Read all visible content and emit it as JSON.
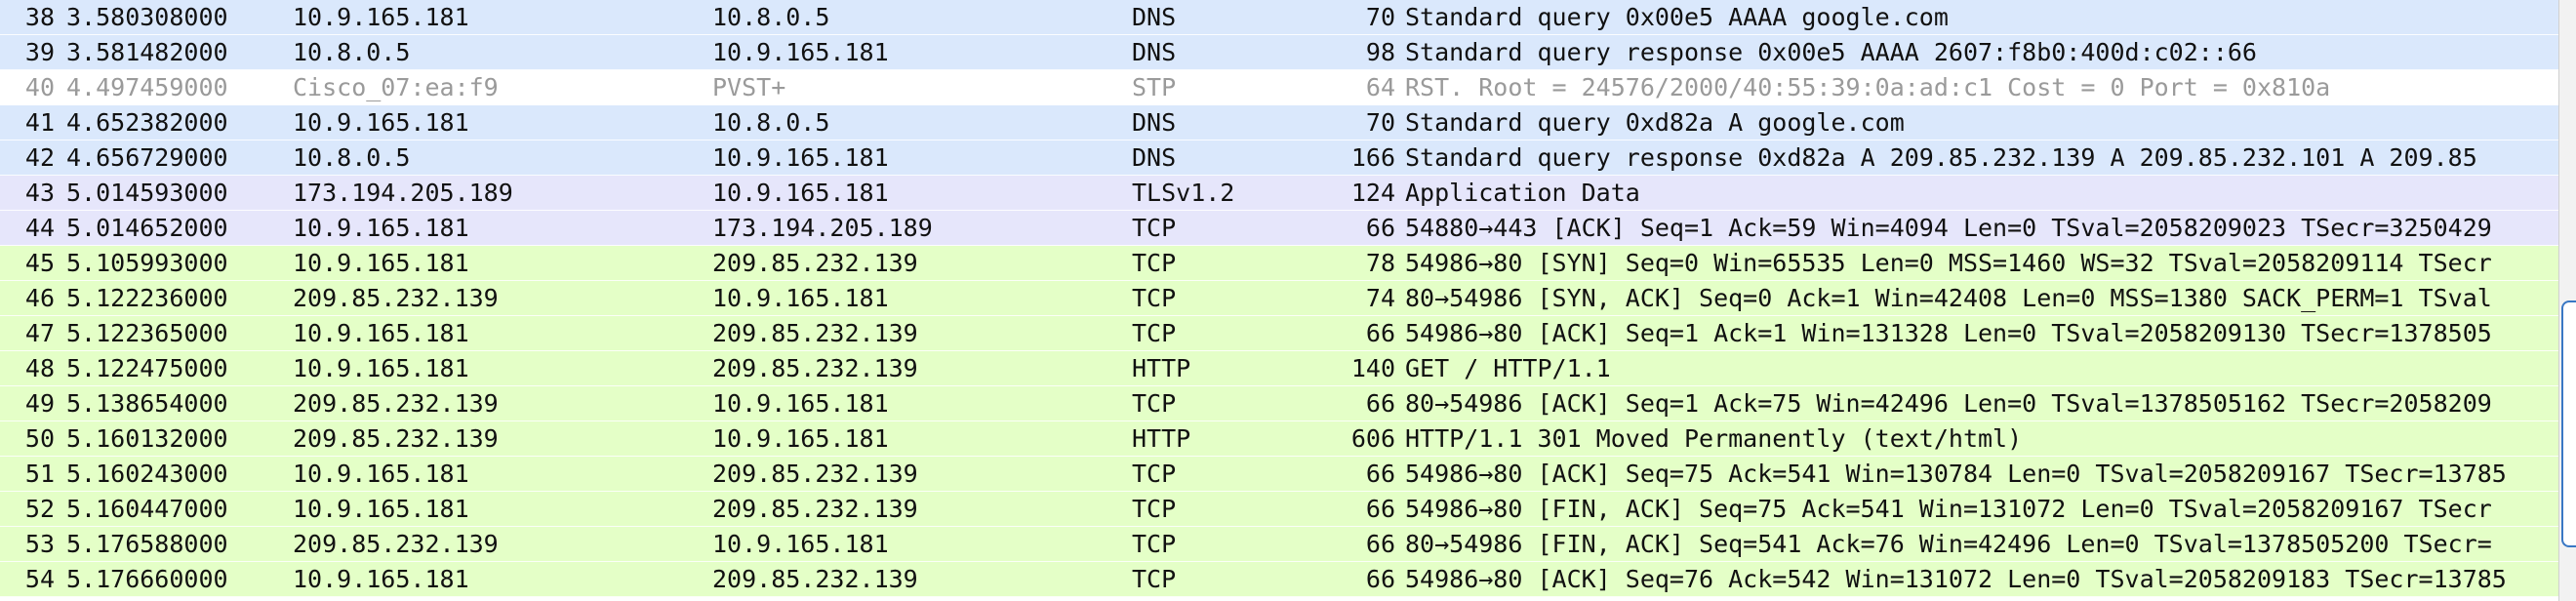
{
  "rows": [
    {
      "no": "38",
      "time": "3.580308000",
      "src": "10.9.165.181",
      "dst": "10.8.0.5",
      "proto": "DNS",
      "len": "70",
      "info": "Standard query 0x00e5  AAAA google.com",
      "kind": "dns"
    },
    {
      "no": "39",
      "time": "3.581482000",
      "src": "10.8.0.5",
      "dst": "10.9.165.181",
      "proto": "DNS",
      "len": "98",
      "info": "Standard query response 0x00e5  AAAA 2607:f8b0:400d:c02::66",
      "kind": "dns"
    },
    {
      "no": "40",
      "time": "4.497459000",
      "src": "Cisco_07:ea:f9",
      "dst": "PVST+",
      "proto": "STP",
      "len": "64",
      "info": "RST. Root = 24576/2000/40:55:39:0a:ad:c1  Cost = 0  Port = 0x810a",
      "kind": "stp"
    },
    {
      "no": "41",
      "time": "4.652382000",
      "src": "10.9.165.181",
      "dst": "10.8.0.5",
      "proto": "DNS",
      "len": "70",
      "info": "Standard query 0xd82a  A google.com",
      "kind": "dns"
    },
    {
      "no": "42",
      "time": "4.656729000",
      "src": "10.8.0.5",
      "dst": "10.9.165.181",
      "proto": "DNS",
      "len": "166",
      "info": "Standard query response 0xd82a  A 209.85.232.139 A 209.85.232.101 A 209.85",
      "kind": "dns"
    },
    {
      "no": "43",
      "time": "5.014593000",
      "src": "173.194.205.189",
      "dst": "10.9.165.181",
      "proto": "TLSv1.2",
      "len": "124",
      "info": "Application Data",
      "kind": "tls"
    },
    {
      "no": "44",
      "time": "5.014652000",
      "src": "10.9.165.181",
      "dst": "173.194.205.189",
      "proto": "TCP",
      "len": "66",
      "info": "54880→443 [ACK] Seq=1 Ack=59 Win=4094 Len=0 TSval=2058209023 TSecr=3250429",
      "kind": "tls"
    },
    {
      "no": "45",
      "time": "5.105993000",
      "src": "10.9.165.181",
      "dst": "209.85.232.139",
      "proto": "TCP",
      "len": "78",
      "info": "54986→80 [SYN] Seq=0 Win=65535 Len=0 MSS=1460 WS=32 TSval=2058209114 TSecr",
      "kind": "tcp"
    },
    {
      "no": "46",
      "time": "5.122236000",
      "src": "209.85.232.139",
      "dst": "10.9.165.181",
      "proto": "TCP",
      "len": "74",
      "info": "80→54986 [SYN, ACK] Seq=0 Ack=1 Win=42408 Len=0 MSS=1380 SACK_PERM=1 TSval",
      "kind": "tcp"
    },
    {
      "no": "47",
      "time": "5.122365000",
      "src": "10.9.165.181",
      "dst": "209.85.232.139",
      "proto": "TCP",
      "len": "66",
      "info": "54986→80 [ACK] Seq=1 Ack=1 Win=131328 Len=0 TSval=2058209130 TSecr=1378505",
      "kind": "tcp"
    },
    {
      "no": "48",
      "time": "5.122475000",
      "src": "10.9.165.181",
      "dst": "209.85.232.139",
      "proto": "HTTP",
      "len": "140",
      "info": "GET / HTTP/1.1",
      "kind": "http"
    },
    {
      "no": "49",
      "time": "5.138654000",
      "src": "209.85.232.139",
      "dst": "10.9.165.181",
      "proto": "TCP",
      "len": "66",
      "info": "80→54986 [ACK] Seq=1 Ack=75 Win=42496 Len=0 TSval=1378505162 TSecr=2058209",
      "kind": "tcp"
    },
    {
      "no": "50",
      "time": "5.160132000",
      "src": "209.85.232.139",
      "dst": "10.9.165.181",
      "proto": "HTTP",
      "len": "606",
      "info": "HTTP/1.1 301 Moved Permanently  (text/html)",
      "kind": "http"
    },
    {
      "no": "51",
      "time": "5.160243000",
      "src": "10.9.165.181",
      "dst": "209.85.232.139",
      "proto": "TCP",
      "len": "66",
      "info": "54986→80 [ACK] Seq=75 Ack=541 Win=130784 Len=0 TSval=2058209167 TSecr=13785",
      "kind": "tcp"
    },
    {
      "no": "52",
      "time": "5.160447000",
      "src": "10.9.165.181",
      "dst": "209.85.232.139",
      "proto": "TCP",
      "len": "66",
      "info": "54986→80 [FIN, ACK] Seq=75 Ack=541 Win=131072 Len=0 TSval=2058209167 TSecr",
      "kind": "tcp"
    },
    {
      "no": "53",
      "time": "5.176588000",
      "src": "209.85.232.139",
      "dst": "10.9.165.181",
      "proto": "TCP",
      "len": "66",
      "info": "80→54986 [FIN, ACK] Seq=541 Ack=76 Win=42496 Len=0 TSval=1378505200 TSecr=",
      "kind": "tcp"
    },
    {
      "no": "54",
      "time": "5.176660000",
      "src": "10.9.165.181",
      "dst": "209.85.232.139",
      "proto": "TCP",
      "len": "66",
      "info": "54986→80 [ACK] Seq=76 Ack=542 Win=131072 Len=0 TSval=2058209183 TSecr=13785",
      "kind": "tcp"
    }
  ],
  "colors": {
    "dns": "#dae8fc",
    "stp": "#ffffff",
    "tls": "#e6e6fb",
    "tcp": "#e4ffc7",
    "http": "#e4ffc7",
    "scroll_accent": "#3a78c4"
  },
  "scrollbar": {
    "thumb_start_fraction": 0.5,
    "thumb_length_fraction": 0.41
  }
}
